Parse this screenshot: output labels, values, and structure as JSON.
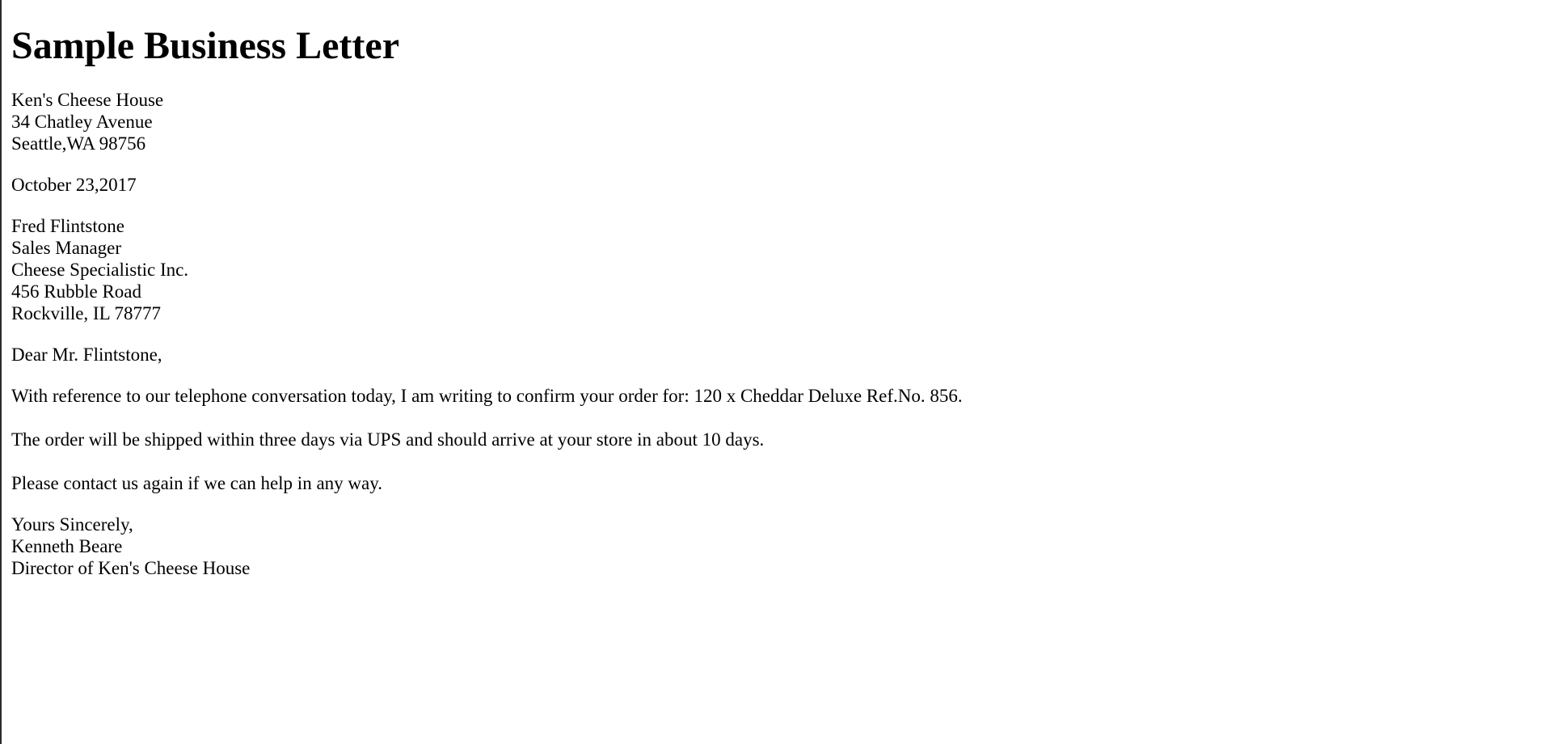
{
  "title": "Sample Business Letter",
  "sender": {
    "name": "Ken's Cheese House",
    "street": "34 Chatley Avenue",
    "city": "Seattle,WA 98756"
  },
  "date": "October 23,2017",
  "recipient": {
    "name": "Fred Flintstone",
    "position": "Sales Manager",
    "company": "Cheese Specialistic Inc.",
    "street": "456 Rubble Road",
    "city": "Rockville, IL 78777"
  },
  "salutation": "Dear Mr. Flintstone,",
  "body": {
    "paragraph_1": "With reference to our telephone conversation today, I am writing to confirm your order for: 120 x Cheddar Deluxe Ref.No. 856.",
    "paragraph_2": "The order will be shipped within three days via UPS and should arrive at your store in about 10 days.",
    "paragraph_3": "Please contact us again if we can help in any way."
  },
  "closing": {
    "valediction": "Yours Sincerely,",
    "signer_name": "Kenneth Beare",
    "signer_title": "Director of Ken's Cheese House"
  }
}
